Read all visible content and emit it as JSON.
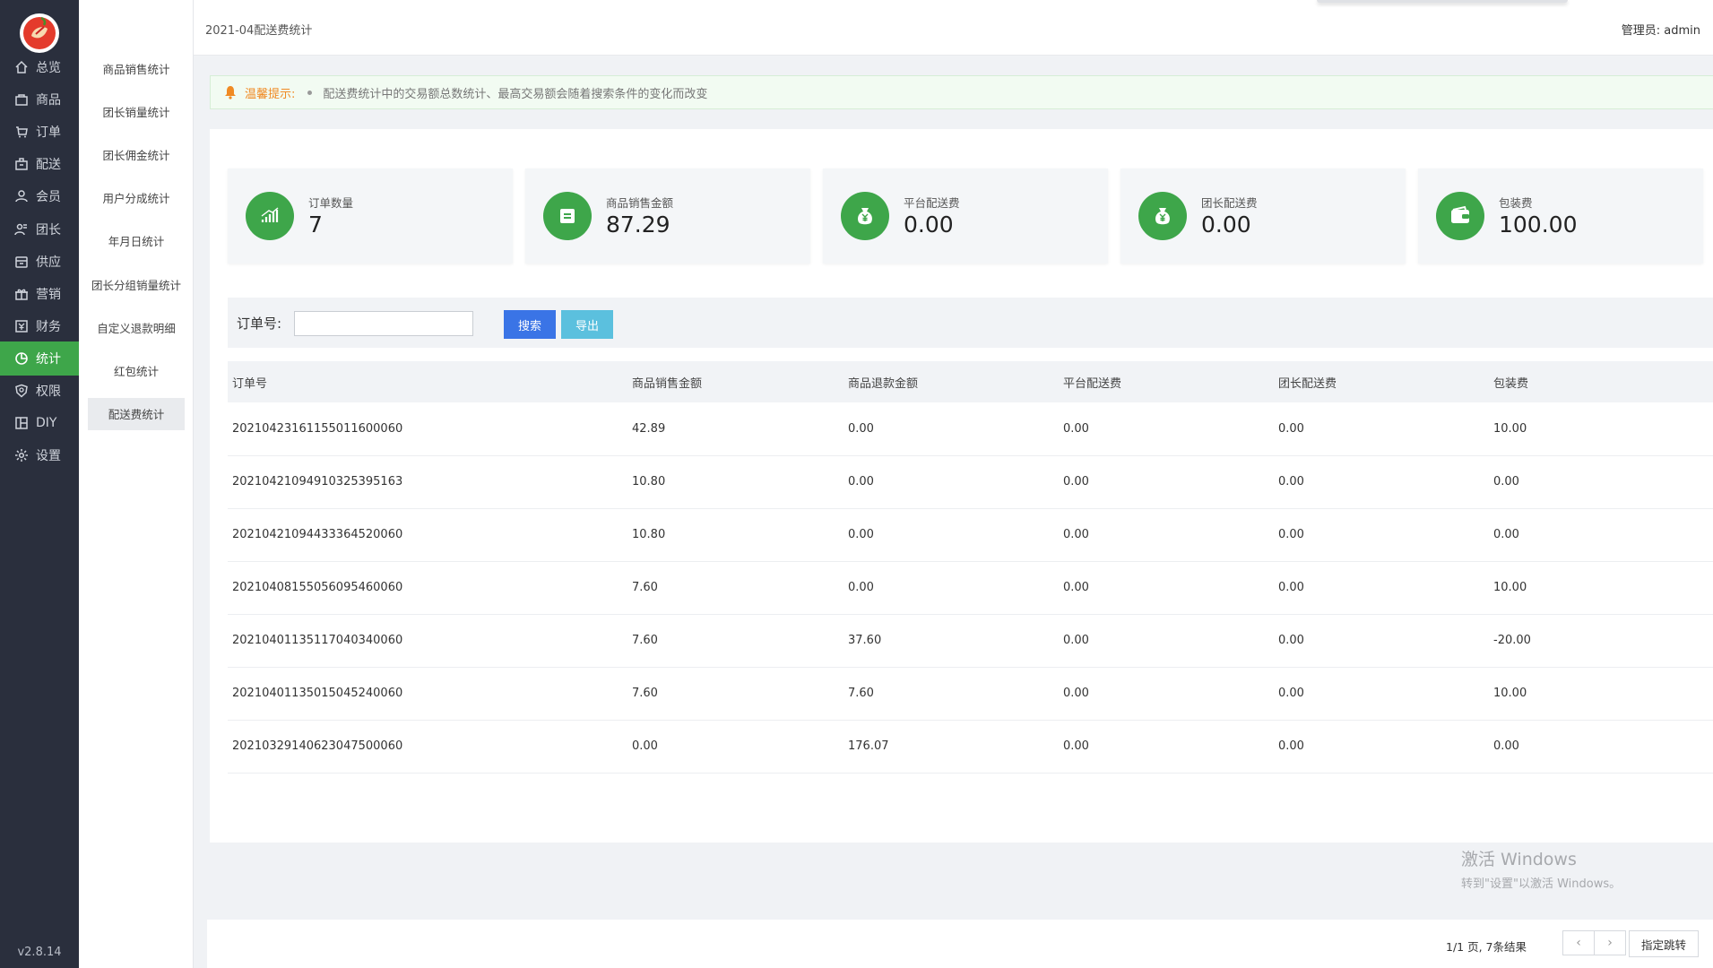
{
  "nav": {
    "items": [
      {
        "label": "总览",
        "icon": "home-icon"
      },
      {
        "label": "商品",
        "icon": "bag-icon"
      },
      {
        "label": "订单",
        "icon": "cart-icon"
      },
      {
        "label": "配送",
        "icon": "delivery-icon"
      },
      {
        "label": "会员",
        "icon": "user-icon"
      },
      {
        "label": "团长",
        "icon": "group-icon"
      },
      {
        "label": "供应",
        "icon": "supply-icon"
      },
      {
        "label": "营销",
        "icon": "gift-icon"
      },
      {
        "label": "财务",
        "icon": "finance-icon"
      },
      {
        "label": "统计",
        "icon": "chart-icon"
      },
      {
        "label": "权限",
        "icon": "shield-icon"
      },
      {
        "label": "DIY",
        "icon": "layout-icon"
      },
      {
        "label": "设置",
        "icon": "gear-icon"
      }
    ],
    "active_index": 9,
    "version": "v2.8.14",
    "accent": "#3ea64a"
  },
  "subnav": {
    "items": [
      "商品销售统计",
      "团长销量统计",
      "团长佣金统计",
      "用户分成统计",
      "年月日统计",
      "团长分组销量统计",
      "自定义退款明细",
      "红包统计",
      "配送费统计"
    ],
    "active_index": 8
  },
  "header": {
    "breadcrumb": "2021-04配送费统计",
    "admin": "管理员:  admin"
  },
  "tip": {
    "label": "温馨提示:",
    "message": "配送费统计中的交易额总数统计、最高交易额会随着搜索条件的变化而改变"
  },
  "stats": [
    {
      "title": "订单数量",
      "value": "7",
      "icon": "bar-chart-icon"
    },
    {
      "title": "商品销售金额",
      "value": "87.29",
      "icon": "document-icon"
    },
    {
      "title": "平台配送费",
      "value": "0.00",
      "icon": "money-bag-icon"
    },
    {
      "title": "团长配送费",
      "value": "0.00",
      "icon": "money-bag-icon"
    },
    {
      "title": "包装费",
      "value": "100.00",
      "icon": "wallet-icon"
    }
  ],
  "search": {
    "label": "订单号:",
    "value": "",
    "search_button": "搜索",
    "export_button": "导出"
  },
  "table": {
    "headers": [
      "订单号",
      "商品销售金额",
      "商品退款金额",
      "平台配送费",
      "团长配送费",
      "包装费"
    ],
    "rows": [
      [
        "20210423161155011600060",
        "42.89",
        "0.00",
        "0.00",
        "0.00",
        "10.00"
      ],
      [
        "20210421094910325395163",
        "10.80",
        "0.00",
        "0.00",
        "0.00",
        "0.00"
      ],
      [
        "20210421094433364520060",
        "10.80",
        "0.00",
        "0.00",
        "0.00",
        "0.00"
      ],
      [
        "20210408155056095460060",
        "7.60",
        "0.00",
        "0.00",
        "0.00",
        "10.00"
      ],
      [
        "20210401135117040340060",
        "7.60",
        "37.60",
        "0.00",
        "0.00",
        "-20.00"
      ],
      [
        "20210401135015045240060",
        "7.60",
        "7.60",
        "0.00",
        "0.00",
        "10.00"
      ],
      [
        "20210329140623047500060",
        "0.00",
        "176.07",
        "0.00",
        "0.00",
        "0.00"
      ]
    ]
  },
  "pager": {
    "info": "1/1 页, 7条结果",
    "prev": "‹",
    "next": "›",
    "jump_label": "指定跳转"
  },
  "watermark": {
    "line1": "激活 Windows",
    "line2": "转到\"设置\"以激活 Windows。"
  }
}
